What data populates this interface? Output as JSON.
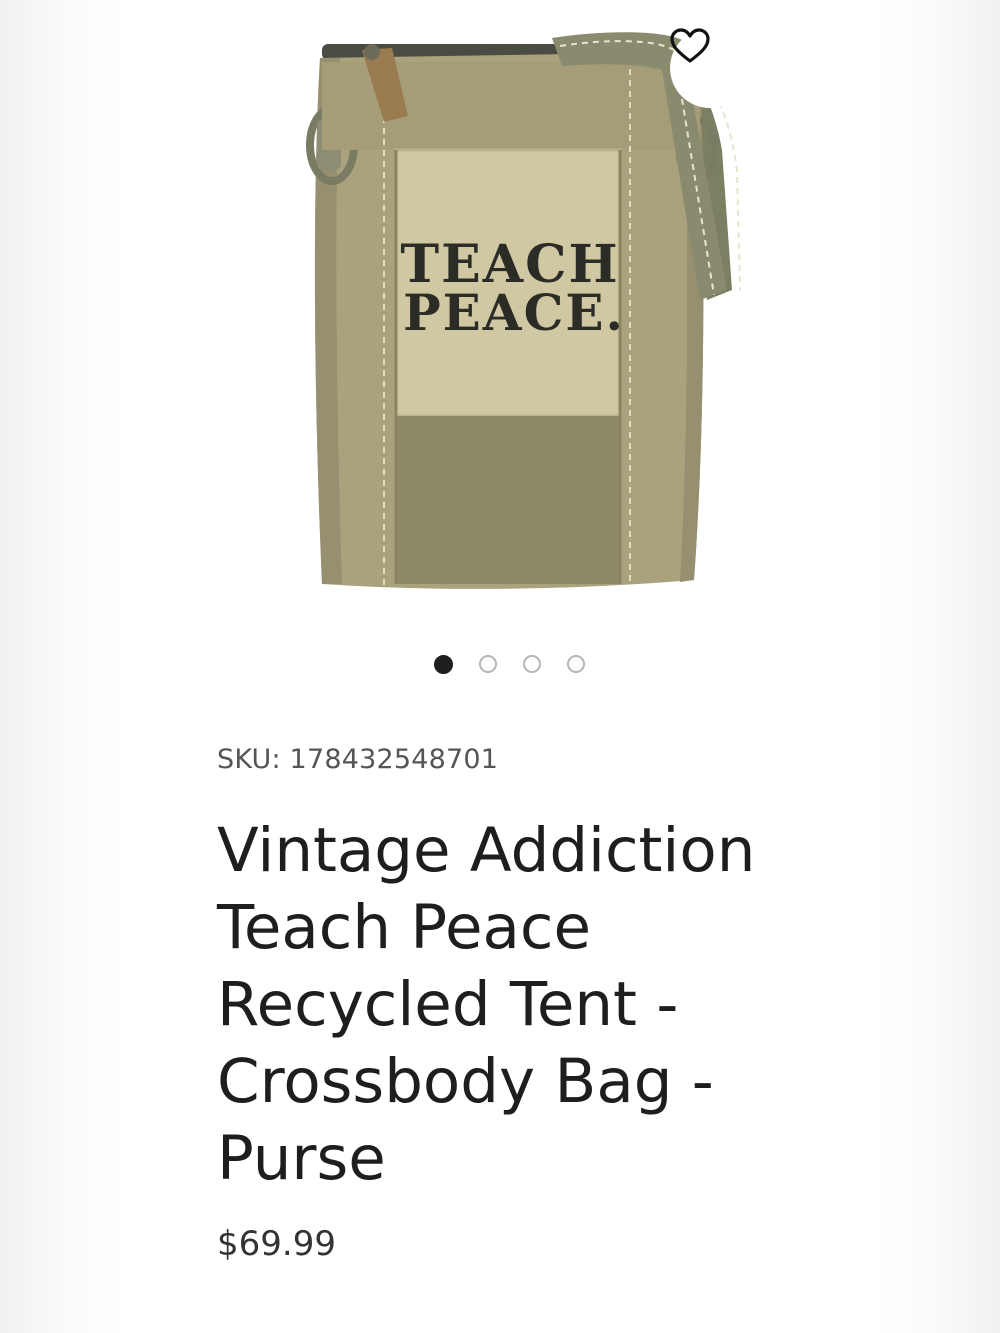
{
  "product": {
    "image_alt": "Crossbody bag",
    "bag_print_line1": "TEACH",
    "bag_print_line2": "PEACE.",
    "sku_label": "SKU: 178432548701",
    "title": "Vintage Addiction Teach Peace Recycled Tent - Crossbody Bag - Purse",
    "price": "$69.99"
  },
  "gallery": {
    "total_images": 4,
    "active_index": 1
  },
  "colors": {
    "canvas_olive": "#a9a27c",
    "canvas_light": "#cfc8a3",
    "strap": "#8a8b6e",
    "text_dark": "#1e1e1e"
  },
  "icons": {
    "favorite": "heart-outline-icon"
  }
}
